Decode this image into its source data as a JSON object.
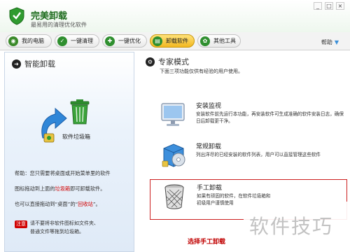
{
  "app": {
    "title": "完美卸载",
    "subtitle": "最易用的清理优化软件"
  },
  "window_controls": {
    "minimize": "_",
    "restore": "□",
    "close": "×"
  },
  "toolbar": {
    "tabs": [
      {
        "label": "我的电脑",
        "icon": "computer-icon",
        "color": "#3b8a2a",
        "glyph": "◉"
      },
      {
        "label": "一键清理",
        "icon": "broom-icon",
        "color": "#2f8f2f",
        "glyph": "✓"
      },
      {
        "label": "一键优化",
        "icon": "wrench-icon",
        "color": "#2f8f2f",
        "glyph": "✚"
      },
      {
        "label": "卸载软件",
        "icon": "uninstall-icon",
        "color": "#2f8f2f",
        "glyph": "▤",
        "active": true
      },
      {
        "label": "其他工具",
        "icon": "tools-icon",
        "color": "#2f8f2f",
        "glyph": "✿"
      }
    ],
    "help_label": "帮助"
  },
  "left_panel": {
    "title": "智能卸载",
    "trash_caption": "软件垃圾箱",
    "help": {
      "line1": "帮助：您只需要将桌面或开始菜单里的软件",
      "line2_pre": "图标拖动到上面的",
      "line2_red": "垃圾箱",
      "line2_post": "即可卸载软件。",
      "line3_pre": "也可以直接拖动到“桌面”的“",
      "line3_red": "回收站",
      "line3_post": "”。"
    },
    "note": {
      "badge": "注意",
      "line1": "请不要将非软件图标如文件夹、",
      "line2": "普通文件等拖到垃圾箱。"
    }
  },
  "right_panel": {
    "title": "专家模式",
    "subtitle": "下面三项功能仅供有经验的用户使用。",
    "options": {
      "install_monitor": {
        "title": "安装监视",
        "desc": "安装软件前先运行本功能，再安装软件可生成准确的软件安装日志，确保日后卸载更干净。"
      },
      "normal_uninstall": {
        "title": "常规卸载",
        "desc": "列出洋尽的已经安装的软件列表，用户可以直接管理这些软件"
      },
      "manual_uninstall": {
        "title": "手工卸载",
        "desc_line1": "如果有顽固的软件，在软件垃圾箱和",
        "desc_line2": "初级用户谨慎使用"
      }
    },
    "select_label": "选择手工卸载"
  },
  "watermark": "软件技巧"
}
